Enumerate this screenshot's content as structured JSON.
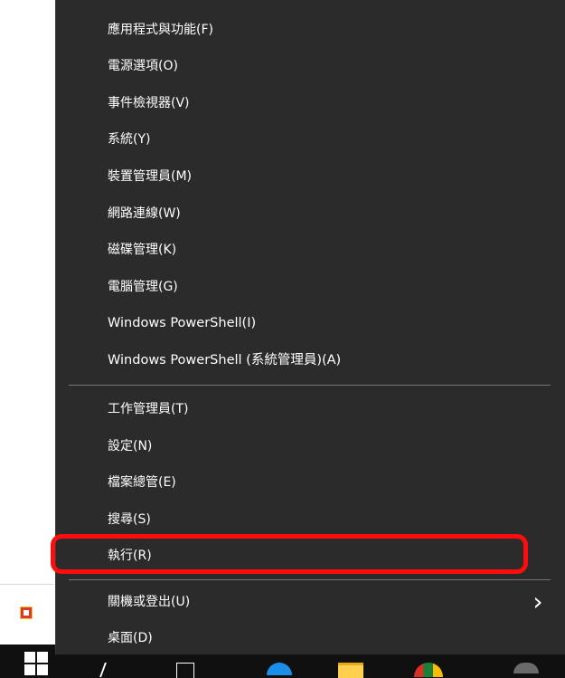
{
  "context_menu": {
    "items": [
      {
        "label": "應用程式與功能(F)"
      },
      {
        "label": "電源選項(O)"
      },
      {
        "label": "事件檢視器(V)"
      },
      {
        "label": "系統(Y)"
      },
      {
        "label": "裝置管理員(M)"
      },
      {
        "label": "網路連線(W)"
      },
      {
        "label": "磁碟管理(K)"
      },
      {
        "label": "電腦管理(G)"
      },
      {
        "label": "Windows PowerShell(I)"
      },
      {
        "label": "Windows PowerShell (系統管理員)(A)"
      },
      {
        "label": "工作管理員(T)"
      },
      {
        "label": "設定(N)"
      },
      {
        "label": "檔案總管(E)"
      },
      {
        "label": "搜尋(S)"
      },
      {
        "label": "執行(R)"
      },
      {
        "label": "關機或登出(U)",
        "submenu_icon": "chevron-right-icon"
      },
      {
        "label": "桌面(D)"
      }
    ]
  },
  "taskbar": {
    "icons": [
      "windows-start-icon",
      "search-icon",
      "task-view-icon",
      "edge-browser-icon",
      "file-explorer-icon",
      "chrome-browser-icon",
      "app-icon"
    ]
  },
  "colors": {
    "menu_background": "#2b2b2b",
    "menu_text": "#ffffff",
    "separator": "#767676",
    "highlight_outline": "#ff0d0d",
    "taskbar_background": "#101010"
  }
}
